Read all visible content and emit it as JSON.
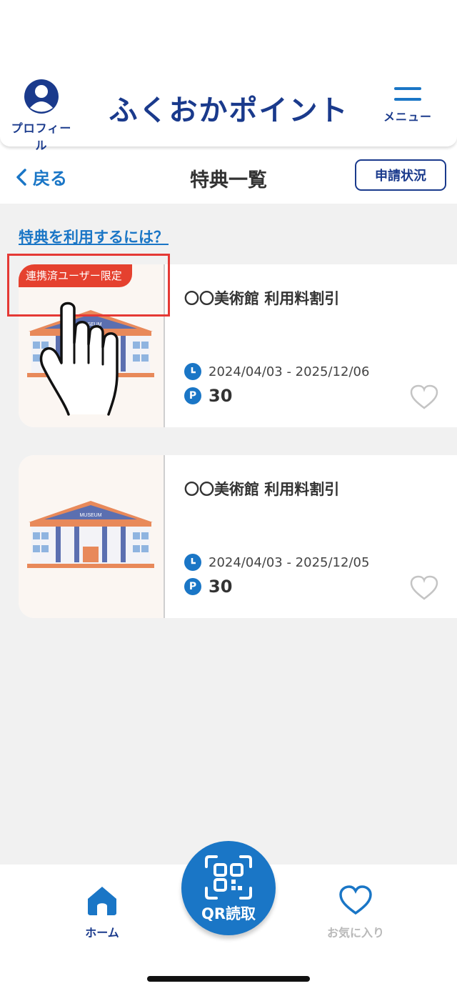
{
  "header": {
    "profile_label": "プロフィール",
    "logo_text": "ふくおかポイント",
    "menu_label": "メニュー"
  },
  "subnav": {
    "back_label": "戻る",
    "title": "特典一覧",
    "status_button": "申請状況"
  },
  "howto_link": "特典を利用するには？",
  "benefits": [
    {
      "badge": "連携済ユーザー限定",
      "title": "〇〇美術館 利用料割引",
      "period": "2024/04/03 - 2025/12/06",
      "points": "30",
      "image_sign": "MUSEUM",
      "favorited": false
    },
    {
      "title": "〇〇美術館 利用料割引",
      "period": "2024/04/03 - 2025/12/05",
      "points": "30",
      "image_sign": "MUSEUM",
      "favorited": false
    }
  ],
  "bottom_nav": {
    "home_label": "ホーム",
    "qr_label": "QR読取",
    "favorites_label": "お気に入り"
  },
  "colors": {
    "brand_navy": "#1a3a8c",
    "accent_blue": "#1a76c6",
    "badge_red": "#e5412f",
    "highlight_red": "#e53935"
  },
  "icons": [
    "profile-icon",
    "menu-icon",
    "chevron-left-icon",
    "clock-icon",
    "point-icon",
    "heart-icon",
    "home-icon",
    "qr-scan-icon",
    "hand-pointer-icon"
  ]
}
